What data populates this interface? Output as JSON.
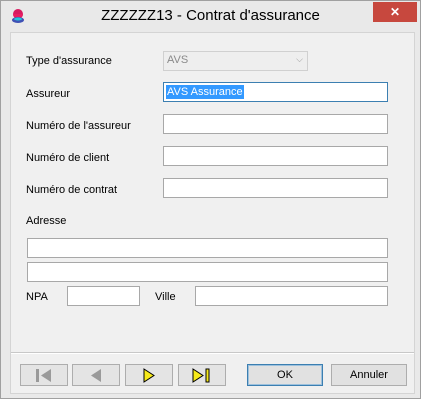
{
  "window": {
    "title": "ZZZZZZ13 - Contrat d'assurance",
    "close_glyph": "✕",
    "icon": "app-palette-icon"
  },
  "form": {
    "type_label": "Type d'assurance",
    "type_value": "AVS",
    "assureur_label": "Assureur",
    "assureur_value": "AVS Assurance",
    "numero_assureur_label": "Numéro de l'assureur",
    "numero_assureur_value": "",
    "numero_client_label": "Numéro de client",
    "numero_client_value": "",
    "numero_contrat_label": "Numéro de contrat",
    "numero_contrat_value": "",
    "adresse_label": "Adresse",
    "adresse_line1": "",
    "adresse_line2": "",
    "npa_label": "NPA",
    "npa_value": "",
    "ville_label": "Ville",
    "ville_value": ""
  },
  "nav": {
    "first_icon": "first-record-icon",
    "prev_icon": "previous-record-icon",
    "next_icon": "next-record-icon",
    "last_icon": "last-record-icon"
  },
  "buttons": {
    "ok_label": "OK",
    "cancel_label": "Annuler"
  },
  "colors": {
    "selection": "#3399ff",
    "close_button": "#c7483e",
    "nav_active_fill": "#f6ea1a",
    "nav_disabled_fill": "#9a9a9a"
  }
}
